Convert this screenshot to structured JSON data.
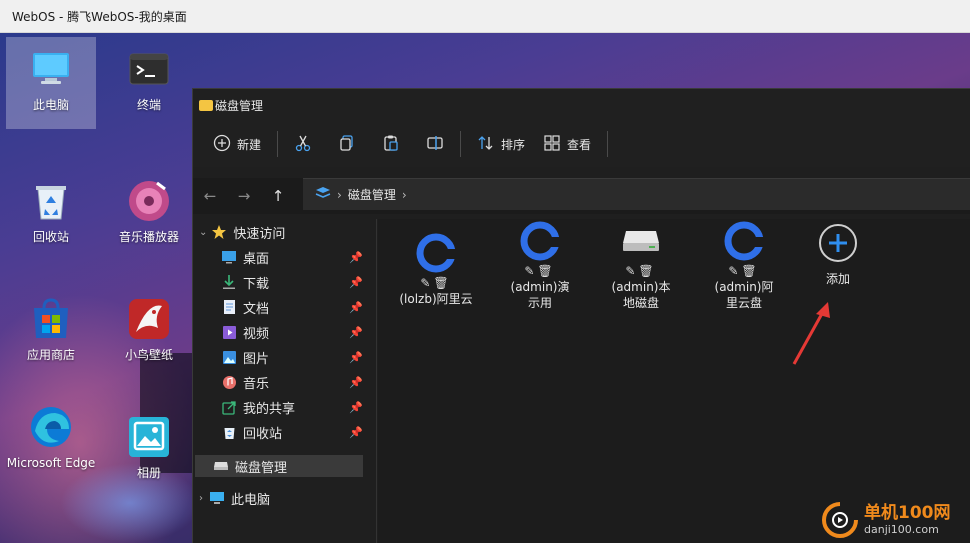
{
  "browser": {
    "title": "WebOS - 腾飞WebOS-我的桌面"
  },
  "desktop": {
    "icons": [
      {
        "label": "此电脑",
        "icon": "monitor-icon"
      },
      {
        "label": "终端",
        "icon": "terminal-icon"
      },
      {
        "label": "回收站",
        "icon": "recycle-bin-icon"
      },
      {
        "label": "音乐播放器",
        "icon": "music-player-icon"
      },
      {
        "label": "应用商店",
        "icon": "app-store-icon"
      },
      {
        "label": "小鸟壁纸",
        "icon": "wallpaper-icon"
      },
      {
        "label": "Microsoft Edge",
        "icon": "edge-icon"
      },
      {
        "label": "相册",
        "icon": "photo-album-icon"
      }
    ]
  },
  "explorer": {
    "title": "磁盘管理",
    "toolbar": {
      "new_label": "新建",
      "sort_label": "排序",
      "view_label": "查看"
    },
    "address": {
      "current": "磁盘管理"
    },
    "sidebar": {
      "quick_access": "快速访问",
      "items": [
        {
          "label": "桌面",
          "icon": "desktop-icon",
          "color": "#3aa0e8"
        },
        {
          "label": "下载",
          "icon": "download-icon",
          "color": "#3bb87a"
        },
        {
          "label": "文档",
          "icon": "document-icon",
          "color": "#7aa7e0"
        },
        {
          "label": "视频",
          "icon": "video-icon",
          "color": "#8a5cd8"
        },
        {
          "label": "图片",
          "icon": "picture-icon",
          "color": "#3a8fe0"
        },
        {
          "label": "音乐",
          "icon": "music-icon",
          "color": "#e8706a"
        },
        {
          "label": "我的共享",
          "icon": "share-icon",
          "color": "#3bb87a"
        },
        {
          "label": "回收站",
          "icon": "recycle-bin-icon",
          "color": "#4a90d9"
        }
      ],
      "disk_manager": "磁盘管理",
      "this_pc": "此电脑"
    },
    "drives": [
      {
        "label": "(lolzb)阿里云",
        "icon": "aliyun-drive-icon"
      },
      {
        "label": "(admin)演示用",
        "icon": "aliyun-drive-icon"
      },
      {
        "label": "(admin)本地磁盘",
        "icon": "local-disk-icon"
      },
      {
        "label": "(admin)阿里云盘",
        "icon": "aliyun-drive-icon"
      }
    ],
    "add_label": "添加"
  },
  "watermark": {
    "line1": "单机100网",
    "line2": "danji100.com"
  },
  "colors": {
    "accent": "#2f6fe8",
    "arrow": "#e53935"
  }
}
